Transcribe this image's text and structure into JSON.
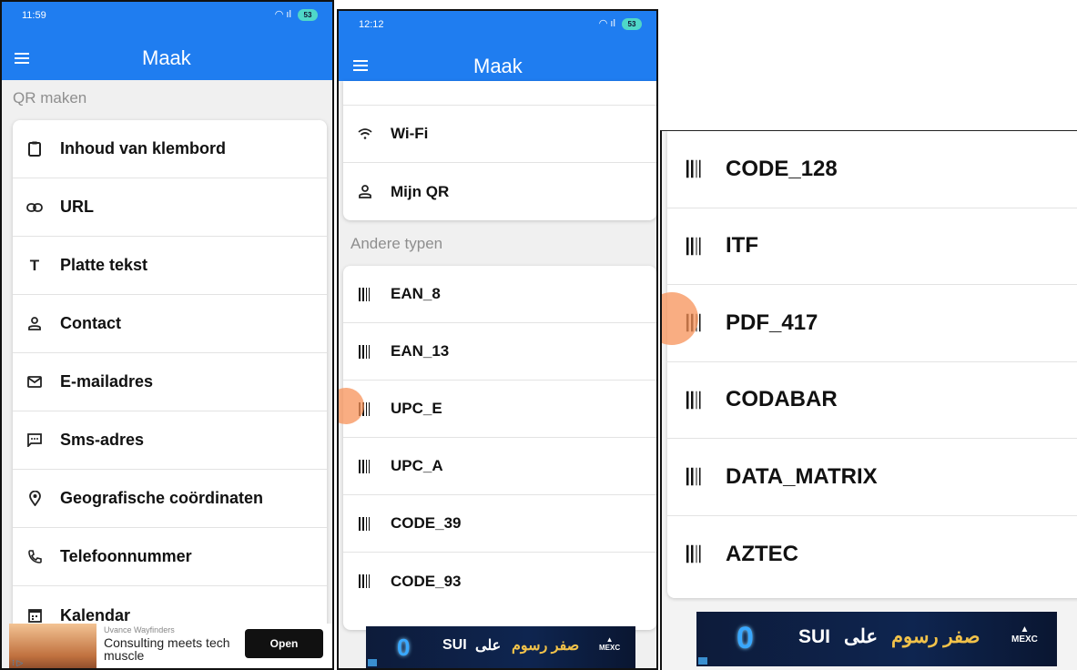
{
  "screen1": {
    "status_time": "11:59",
    "battery": "53",
    "title": "Maak",
    "section_label": "QR maken",
    "items": [
      {
        "icon": "clipboard-icon",
        "label": "Inhoud van klembord"
      },
      {
        "icon": "link-icon",
        "label": "URL"
      },
      {
        "icon": "text-icon",
        "label": "Platte tekst"
      },
      {
        "icon": "person-icon",
        "label": "Contact"
      },
      {
        "icon": "mail-icon",
        "label": "E-mailadres"
      },
      {
        "icon": "sms-icon",
        "label": "Sms-adres"
      },
      {
        "icon": "location-icon",
        "label": "Geografische coördinaten"
      },
      {
        "icon": "phone-icon",
        "label": "Telefoonnummer"
      },
      {
        "icon": "calendar-icon",
        "label": "Kalendar"
      }
    ],
    "ad": {
      "advertiser": "Uvance Wayfinders",
      "text": "Consulting meets tech muscle",
      "button": "Open"
    }
  },
  "screen2": {
    "status_time": "12:12",
    "battery": "53",
    "title": "Maak",
    "items_top": [
      {
        "icon": "wifi-icon",
        "label": "Wi-Fi"
      },
      {
        "icon": "person-icon",
        "label": "Mijn QR"
      }
    ],
    "section_label": "Andere typen",
    "items_other": [
      {
        "icon": "barcode-icon",
        "label": "EAN_8"
      },
      {
        "icon": "barcode-icon",
        "label": "EAN_13"
      },
      {
        "icon": "barcode-icon",
        "label": "UPC_E"
      },
      {
        "icon": "barcode-icon",
        "label": "UPC_A"
      },
      {
        "icon": "barcode-icon",
        "label": "CODE_39"
      },
      {
        "icon": "barcode-icon",
        "label": "CODE_93"
      }
    ],
    "ad": {
      "zero": "0",
      "coin": "SUI",
      "arabic_a": "صفر رسوم",
      "arabic_b": "على",
      "brand": "MEXC"
    }
  },
  "screen3": {
    "items": [
      {
        "icon": "barcode-icon",
        "label": "CODE_128"
      },
      {
        "icon": "barcode-icon",
        "label": "ITF"
      },
      {
        "icon": "barcode-icon",
        "label": "PDF_417"
      },
      {
        "icon": "barcode-icon",
        "label": "CODABAR"
      },
      {
        "icon": "barcode-icon",
        "label": "DATA_MATRIX"
      },
      {
        "icon": "barcode-icon",
        "label": "AZTEC"
      }
    ],
    "ad": {
      "zero": "0",
      "coin": "SUI",
      "arabic_a": "صفر رسوم",
      "arabic_b": "على",
      "brand": "MEXC"
    }
  },
  "colors": {
    "appbar": "#1f7df0",
    "touch": "#f79158"
  }
}
